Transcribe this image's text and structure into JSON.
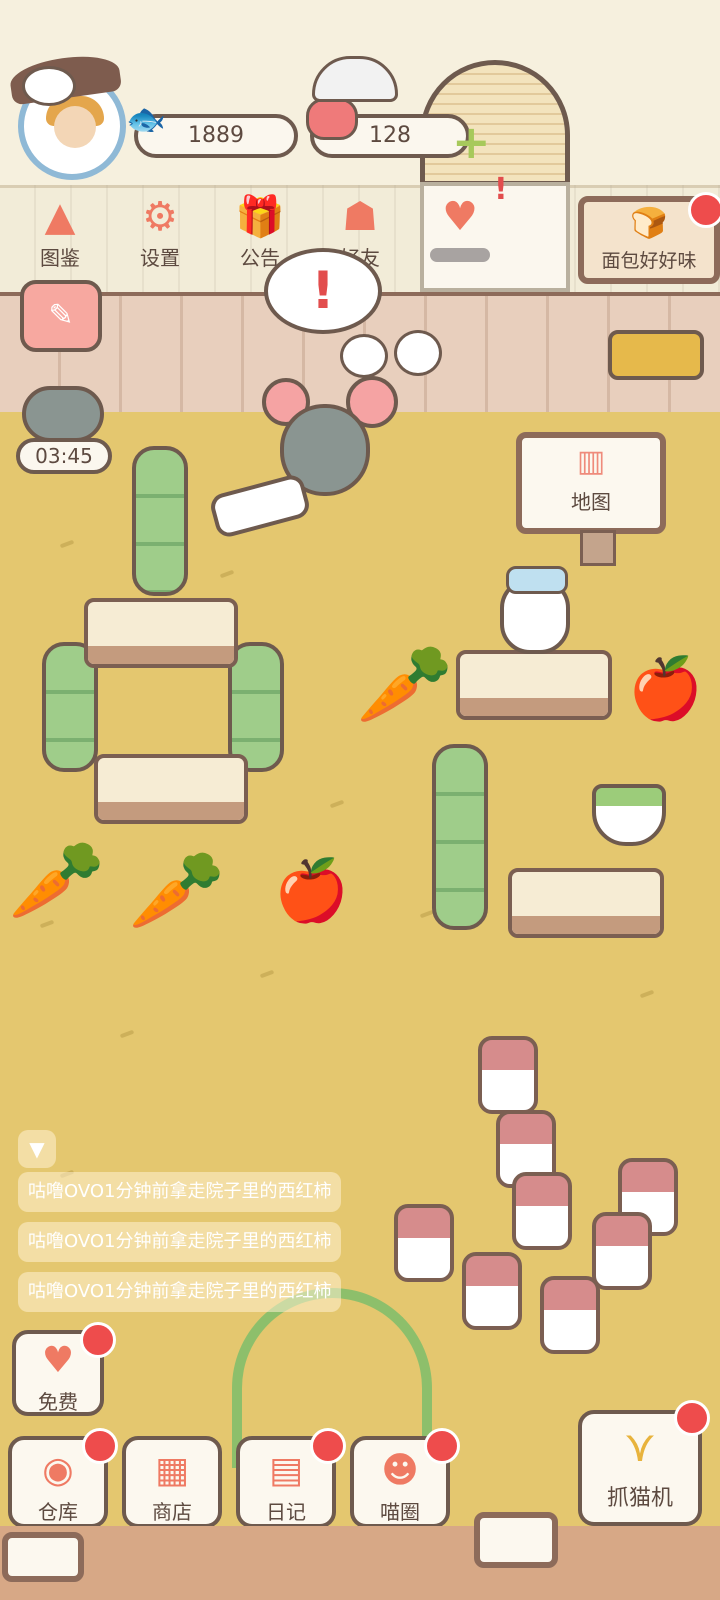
{
  "currency": {
    "fish": "1889",
    "hearts": "128"
  },
  "menu": [
    {
      "label": "图鉴"
    },
    {
      "label": "设置"
    },
    {
      "label": "公告"
    },
    {
      "label": "好友"
    }
  ],
  "bread_sign": "面包好好味",
  "timer": "03:45",
  "map_sign": "地图",
  "feed": [
    "咕噜OVO1分钟前拿走院子里的西红柿",
    "咕噜OVO1分钟前拿走院子里的西红柿",
    "咕噜OVO1分钟前拿走院子里的西红柿"
  ],
  "free_label": "免费",
  "bottom_bar": [
    {
      "label": "仓库"
    },
    {
      "label": "商店"
    },
    {
      "label": "日记"
    },
    {
      "label": "喵圈"
    }
  ],
  "claw_machine": "抓猫机",
  "colors": {
    "accent": "#ef7a63",
    "badge": "#ee4c4c",
    "outline": "#6e5a4e",
    "ground": "#e4c76f"
  }
}
